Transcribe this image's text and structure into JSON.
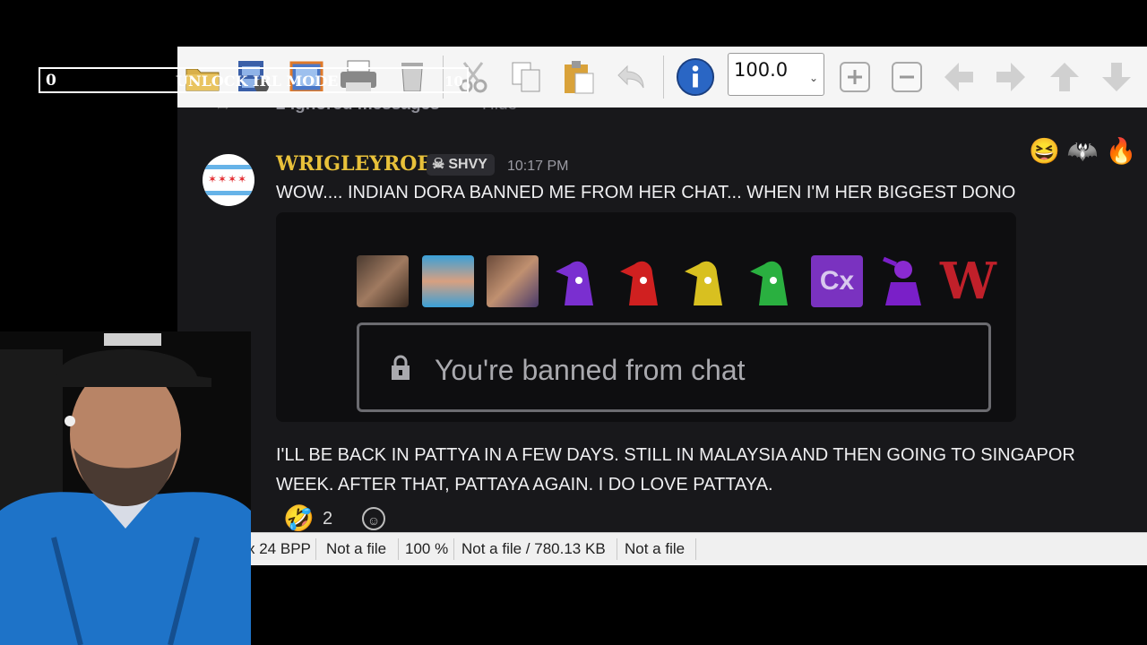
{
  "hud": {
    "count": "0",
    "mode_label": "UNLOCK IRL MODE",
    "goal": "10"
  },
  "toolbar": {
    "zoom_value": "100.0",
    "buttons": [
      "open-folder",
      "filmstrip",
      "slideshow",
      "print",
      "delete",
      "cut",
      "copy",
      "paste",
      "undo",
      "info",
      "zoom-in",
      "zoom-out",
      "previous",
      "next",
      "up",
      "down"
    ]
  },
  "chat": {
    "ignored_text": "2 ignored messages",
    "ignored_hide": "Hide",
    "username": "WRIGLEYROB",
    "badge": "SHVY",
    "timestamp": "10:17 PM",
    "message1": "WOW.... INDIAN DORA  BANNED ME FROM HER CHAT... WHEN I'M HER BIGGEST DONO",
    "embed": {
      "banned_text": "You're banned from chat",
      "emotes": [
        "portrait-1",
        "portrait-2",
        "portrait-3",
        "purple-peepo",
        "red-peepo",
        "yellow-peepo",
        "green-peepo",
        "cx-badge",
        "salute-figure",
        "w-letter"
      ],
      "cx_label": "Cx",
      "w_label": "W"
    },
    "message2_line1": "I'LL BE BACK IN PATTYA IN A FEW DAYS.  STILL IN MALAYSIA AND THEN GOING TO SINGAPOR",
    "message2_line2": "WEEK.  AFTER THAT, PATTAYA AGAIN.  I DO LOVE PATTAYA.",
    "reaction_count": "2",
    "top_reactions": [
      "😆",
      "🦇",
      "🔥"
    ],
    "laugh_reaction": "🤣"
  },
  "statusbar": {
    "bpp": "x 24 BPP",
    "file1": "Not a file",
    "zoom": "100 %",
    "size": "Not a file / 780.13 KB",
    "file2": "Not a file"
  }
}
